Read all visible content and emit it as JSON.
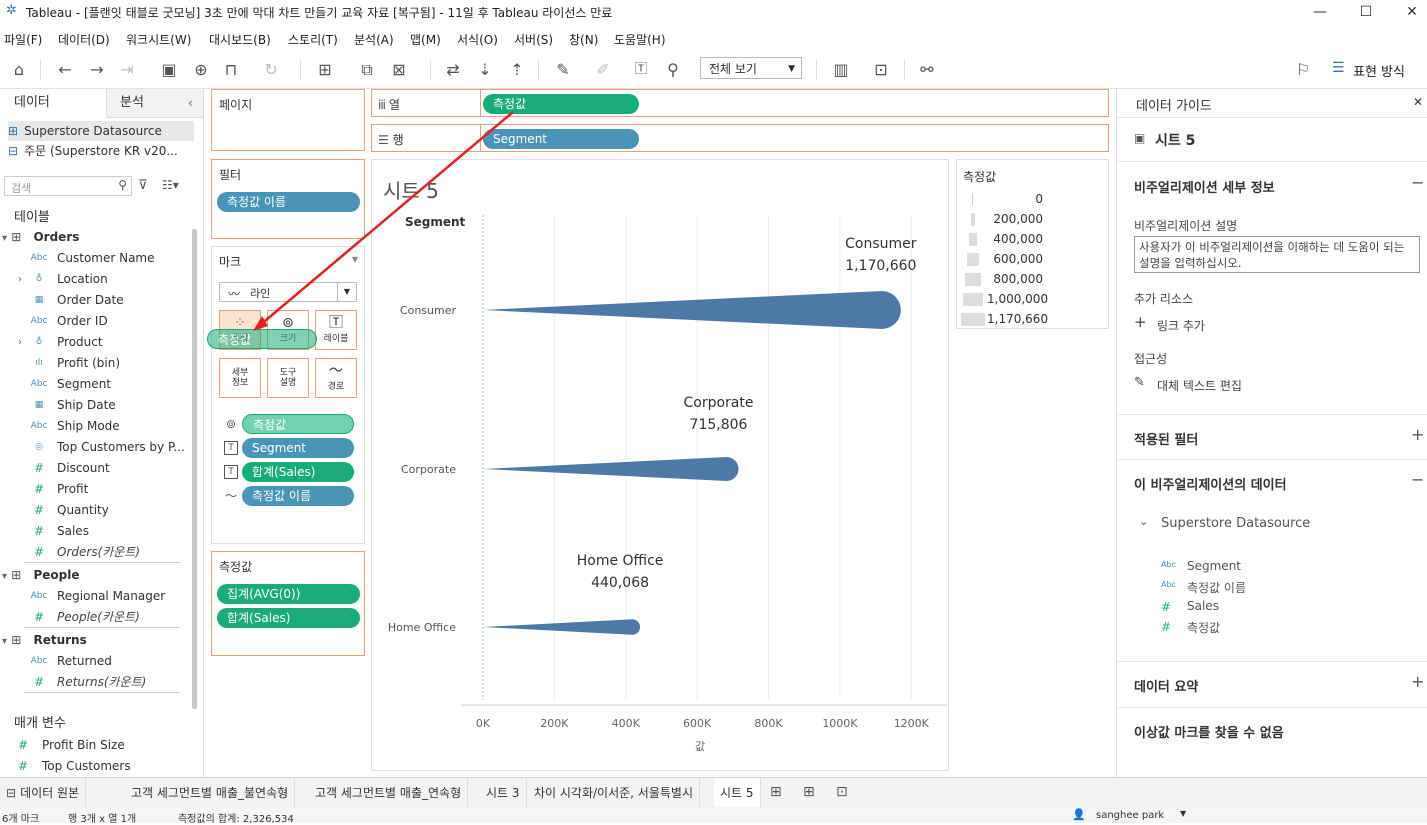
{
  "window": {
    "title": "Tableau - [플랜잇 태블로 굿모닝] 3초 만에 막대 차트 만들기 교육 자료 [복구됨] - 11일 후 Tableau 라이선스 만료",
    "minimize": "—",
    "maximize": "☐",
    "close": "✕"
  },
  "menu": [
    "파일(F)",
    "데이터(D)",
    "워크시트(W)",
    "대시보드(B)",
    "스토리(T)",
    "분석(A)",
    "맵(M)",
    "서식(O)",
    "서버(S)",
    "창(N)",
    "도움말(H)"
  ],
  "toolbar": {
    "fit_value": "전체 보기",
    "show_me": "표현 방식"
  },
  "left_pane": {
    "tab_data": "데이터",
    "tab_analysis": "분석",
    "datasources": [
      "Superstore Datasource",
      "주문 (Superstore KR v20..."
    ],
    "search_placeholder": "검색",
    "tables_label": "테이블",
    "groups": [
      {
        "name": "Orders",
        "fields": [
          {
            "type": "Abc",
            "label": "Customer Name"
          },
          {
            "type": "geo",
            "label": "Location",
            "expand": true
          },
          {
            "type": "date",
            "label": "Order Date"
          },
          {
            "type": "Abc",
            "label": "Order ID"
          },
          {
            "type": "hier",
            "label": "Product",
            "expand": true
          },
          {
            "type": "bin",
            "label": "Profit (bin)"
          },
          {
            "type": "Abc",
            "label": "Segment"
          },
          {
            "type": "date",
            "label": "Ship Date"
          },
          {
            "type": "Abc",
            "label": "Ship Mode"
          },
          {
            "type": "set",
            "label": "Top Customers by P..."
          },
          {
            "type": "#",
            "label": "Discount"
          },
          {
            "type": "#",
            "label": "Profit"
          },
          {
            "type": "#",
            "label": "Quantity"
          },
          {
            "type": "#",
            "label": "Sales"
          },
          {
            "type": "#",
            "label": "Orders(카운트)",
            "italic": true
          }
        ]
      },
      {
        "name": "People",
        "fields": [
          {
            "type": "Abc",
            "label": "Regional Manager"
          },
          {
            "type": "#",
            "label": "People(카운트)",
            "italic": true
          }
        ]
      },
      {
        "name": "Returns",
        "fields": [
          {
            "type": "Abc",
            "label": "Returned"
          },
          {
            "type": "#",
            "label": "Returns(카운트)",
            "italic": true
          }
        ]
      }
    ],
    "params_label": "매개 변수",
    "params": [
      "Profit Bin Size",
      "Top Customers"
    ]
  },
  "cards": {
    "pages": "페이지",
    "filters": "필터",
    "filter_pill": "측정값 이름",
    "marks": "마크",
    "mark_type": "라인",
    "mark_buttons": {
      "color": "색상",
      "size": "크기",
      "label": "레이블",
      "detail": "세부\n정보",
      "tooltip": "도구\n설명",
      "path": "경로"
    },
    "drag_pill": "측정값",
    "encodings": [
      {
        "icon": "size",
        "label": "측정값",
        "color": "light-green"
      },
      {
        "icon": "T",
        "label": "Segment",
        "color": "blue"
      },
      {
        "icon": "T",
        "label": "합계(Sales)",
        "color": "green"
      },
      {
        "icon": "path",
        "label": "측정값 이름",
        "color": "blue"
      }
    ],
    "measure_values": "측정값",
    "measure_pills": [
      "집계(AVG(0))",
      "합계(Sales)"
    ]
  },
  "shelves": {
    "columns_label": "열",
    "columns_pill": "측정값",
    "rows_label": "행",
    "rows_pill": "Segment"
  },
  "viz": {
    "sheet_title": "시트 5",
    "header": "Segment",
    "xlabel": "값"
  },
  "chart_data": {
    "type": "bar",
    "categories": [
      "Consumer",
      "Corporate",
      "Home Office"
    ],
    "values": [
      1170660,
      715806,
      440068
    ],
    "value_labels": [
      "1,170,660",
      "715,806",
      "440,068"
    ],
    "xlabel": "값",
    "ylabel": "Segment",
    "xlim": [
      0,
      1300000
    ],
    "xticks": [
      "0K",
      "200K",
      "400K",
      "600K",
      "800K",
      "1000K",
      "1200K"
    ],
    "color": "#4e79a7",
    "mark_shape": "tapered line (size-encoded)"
  },
  "legend": {
    "title": "측정값",
    "items": [
      "0",
      "200,000",
      "400,000",
      "600,000",
      "800,000",
      "1,000,000",
      "1,170,660"
    ]
  },
  "right_pane": {
    "title": "데이터 가이드",
    "sheet": "시트 5",
    "viz_details": "비주얼리제이션 세부 정보",
    "desc_label": "비주얼리제이션 설명",
    "desc_placeholder": "사용자가 이 비주얼리제이션을 이해하는 데 도움이 되는 설명을 입력하십시오.",
    "resources_label": "추가 리소스",
    "add_link": "링크 추가",
    "accessibility": "접근성",
    "alt_text": "대체 텍스트 편집",
    "applied_filters": "적용된 필터",
    "viz_data": "이 비주얼리제이션의 데이터",
    "datasource": "Superstore Datasource",
    "data_fields": [
      {
        "type": "Abc",
        "label": "Segment"
      },
      {
        "type": "Abc",
        "label": "측정값 이름"
      },
      {
        "type": "#",
        "label": "Sales"
      },
      {
        "type": "#",
        "label": "측정값"
      }
    ],
    "data_summary": "데이터 요약",
    "outliers": "이상값 마크를 찾을 수 없음"
  },
  "bottom_tabs": [
    "데이터 원본",
    "고객 세그먼트별 매출_불연속형",
    "고객 세그먼트별 매출_연속형",
    "시트 3",
    "차이 시각화/이서준, 서울특별시",
    "시트 5"
  ],
  "status": {
    "marks": "6개 마크",
    "rows_cols": "행 3개 x 열 1개",
    "sum": "측정값의 합계: 2,326,534",
    "user": "sanghee park"
  }
}
